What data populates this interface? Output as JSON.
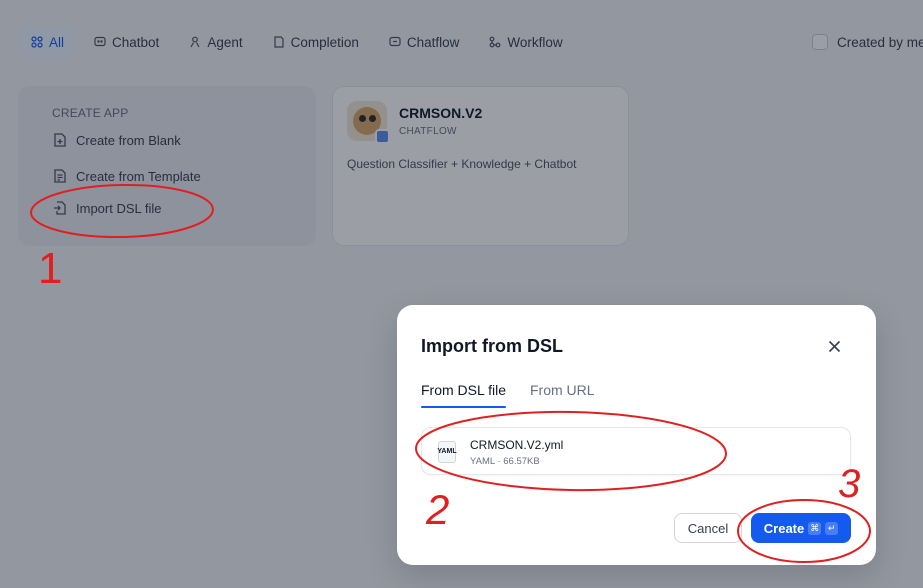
{
  "filters": {
    "tabs": [
      {
        "label": "All",
        "icon": "grid-icon",
        "active": true
      },
      {
        "label": "Chatbot",
        "icon": "chat-bubble-icon"
      },
      {
        "label": "Agent",
        "icon": "agent-icon"
      },
      {
        "label": "Completion",
        "icon": "document-icon"
      },
      {
        "label": "Chatflow",
        "icon": "chatflow-icon"
      },
      {
        "label": "Workflow",
        "icon": "workflow-icon"
      }
    ],
    "created_by_me": "Created by me"
  },
  "create_app": {
    "heading": "CREATE APP",
    "items": [
      {
        "label": "Create from Blank",
        "icon": "file-plus-icon"
      },
      {
        "label": "Create from Template",
        "icon": "file-template-icon"
      },
      {
        "label": "Import DSL file",
        "icon": "file-import-icon"
      }
    ]
  },
  "app_card": {
    "name": "CRMSON.V2",
    "type": "CHATFLOW",
    "description": "Question Classifier + Knowledge + Chatbot"
  },
  "modal": {
    "title": "Import from DSL",
    "tabs": [
      {
        "label": "From DSL file",
        "active": true
      },
      {
        "label": "From URL"
      }
    ],
    "file": {
      "icon_text": "YAML",
      "name": "CRMSON.V2.yml",
      "meta": "YAML · 66.57KB"
    },
    "cancel_label": "Cancel",
    "create_label": "Create",
    "create_shortcut": [
      "⌘",
      "↵"
    ]
  },
  "annotations": {
    "step_1": "1",
    "step_2": "2",
    "step_3": "3",
    "color": "#e02020"
  },
  "colors": {
    "accent": "#155aef",
    "overlay": "rgba(16, 24, 40, 0.42)"
  }
}
